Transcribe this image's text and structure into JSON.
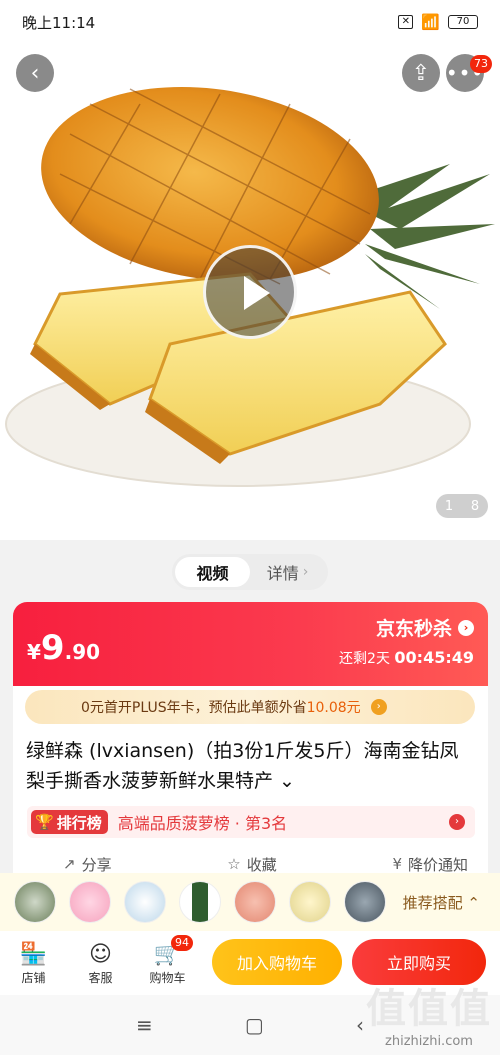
{
  "status_bar": {
    "time": "晚上11:14",
    "battery": "70",
    "sim": "✕"
  },
  "hero": {
    "more_badge": "73",
    "pager_current": "1",
    "pager_total": "8"
  },
  "tabs": [
    {
      "label": "视频"
    },
    {
      "label": "详情"
    }
  ],
  "price": {
    "currency": "¥",
    "integer": "9",
    "decimal": ".90"
  },
  "seckill": {
    "brand": "京东秒杀",
    "countdown_prefix": "还剩",
    "countdown_days": "2天",
    "countdown_time": "00:45:49"
  },
  "plus": {
    "text": "0元首开PLUS年卡，预估此单额外省",
    "amount": "10.08元"
  },
  "product": {
    "title": "绿鲜森 (lvxiansen)（拍3份1斤发5斤）海南金钻凤梨手撕香水菠萝新鲜水果特产 ⌄"
  },
  "rank": {
    "badge": "排行榜",
    "text": "高端品质菠萝榜 · 第3名"
  },
  "actions": [
    {
      "label": "分享"
    },
    {
      "label": "收藏"
    },
    {
      "label": "降价通知"
    }
  ],
  "recommend": {
    "label": "推荐搭配 ⌃"
  },
  "bottom_bar": {
    "store": "店铺",
    "service": "客服",
    "cart": "购物车",
    "cart_badge": "94",
    "add_cart": "加入购物车",
    "buy_now": "立即购买"
  },
  "watermark": {
    "big": "值值值",
    "small": "zhizhizhi.com"
  }
}
